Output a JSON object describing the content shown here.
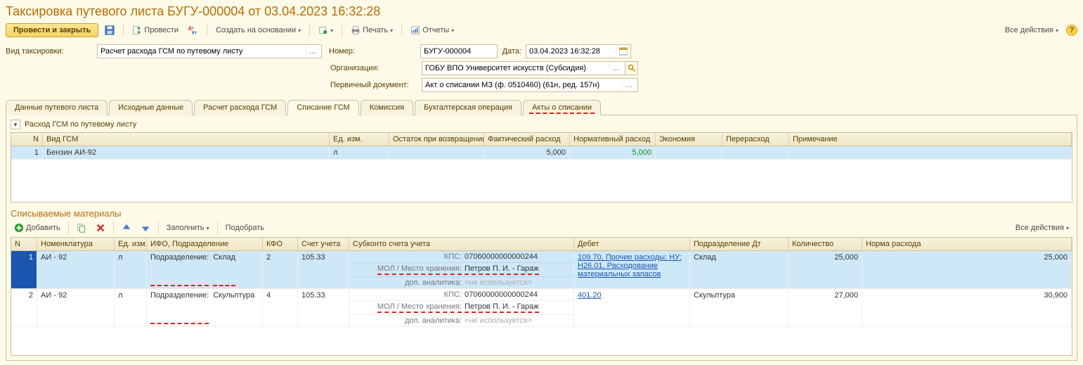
{
  "title": "Таксировка путевого листа БУГУ-000004 от 03.04.2023 16:32:28",
  "toolbar": {
    "provesti_zakryt": "Провести и закрыть",
    "provesti": "Провести",
    "sozdat_na_osnovanii": "Создать на основании",
    "pechat": "Печать",
    "otchety": "Отчеты",
    "vse_deistviya": "Все действия"
  },
  "form": {
    "vid_taksirovki_label": "Вид таксировки:",
    "vid_taksirovki_value": "Расчет расхода ГСМ по путевому листу",
    "nomer_label": "Номер:",
    "nomer_value": "БУГУ-000004",
    "data_label": "Дата:",
    "data_value": "03.04.2023 16:32:28",
    "organizaciya_label": "Организация:",
    "organizaciya_value": "ГОБУ ВПО Университет искусств (Субсидия)",
    "pervichny_label": "Первичный документ:",
    "pervichny_value": "Акт о списании МЗ (ф. 0510460) (61н, ред. 157н)"
  },
  "tabs": [
    {
      "label": "Данные путевого листа"
    },
    {
      "label": "Исходные данные"
    },
    {
      "label": "Расчет расхода ГСМ"
    },
    {
      "label": "Списание ГСМ",
      "active": true
    },
    {
      "label": "Комиссия"
    },
    {
      "label": "Бухгалтерская операция"
    },
    {
      "label": "Акты о списании",
      "red": true
    }
  ],
  "section1": {
    "title": "Расход ГСМ по путевому листу",
    "columns": [
      "N",
      "Вид ГСМ",
      "Ед. изм.",
      "Остаток при возвращении",
      "Фактический расход",
      "Нормативный расход",
      "Экономия",
      "Перерасход",
      "Примечание"
    ],
    "rows": [
      {
        "n": "1",
        "vid": "Бензин АИ-92",
        "ed": "л",
        "ostatok": "",
        "fakt": "5,000",
        "norm": "5,000",
        "ekon": "",
        "pere": "",
        "prim": ""
      }
    ]
  },
  "section2": {
    "title": "Списываемые материалы",
    "toolbar": {
      "dobavit": "Добавить",
      "zapolnit": "Заполнить",
      "podobrat": "Подобрать",
      "vse_deistviya": "Все действия"
    },
    "columns": [
      "N",
      "Номенклатура",
      "Ед. изм.",
      "ИФО, Подразделение",
      "КФО",
      "Счет учета",
      "Субконто счета учета",
      "Дебет",
      "Подразделение Дт",
      "Количество",
      "Норма расхода"
    ],
    "sub_labels": {
      "podrazdelenie": "Подразделение:",
      "kps": "КПС:",
      "mol": "МОЛ / Место хранения:",
      "dop": "доп. аналитика:",
      "ne_isp": "<не используется>"
    },
    "rows": [
      {
        "n": "1",
        "nomen": "АИ - 92",
        "ed": "л",
        "podr": "Склад",
        "kfo": "2",
        "schet": "105.33",
        "kps_val": "07060000000000244",
        "mol_val": "Петров П. И. - Гараж",
        "debet": "109.70, Прочие расходы; НУ: Н26.01, Расходование материальных запасов",
        "podr_dt": "Склад",
        "kol": "25,000",
        "norma": "25,000",
        "selected": true
      },
      {
        "n": "2",
        "nomen": "АИ - 92",
        "ed": "л",
        "podr": "Скульптура",
        "kfo": "4",
        "schet": "105.33",
        "kps_val": "07060000000000244",
        "mol_val": "Петров П. И. - Гараж",
        "debet": "401.20",
        "podr_dt": "Скульптура",
        "kol": "27,000",
        "norma": "30,900",
        "selected": false
      }
    ]
  }
}
